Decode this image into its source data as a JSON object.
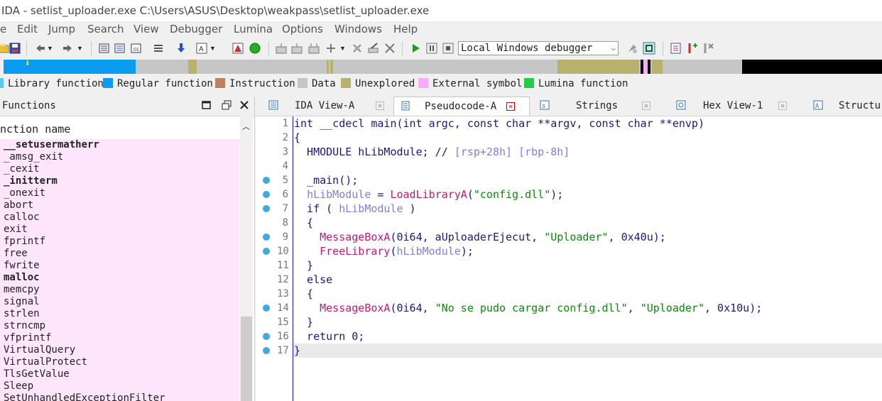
{
  "window": {
    "title": "IDA - setlist_uploader.exe C:\\Users\\ASUS\\Desktop\\weakpass\\setlist_uploader.exe"
  },
  "menu": [
    "e",
    "Edit",
    "Jump",
    "Search",
    "View",
    "Debugger",
    "Lumina",
    "Options",
    "Windows",
    "Help"
  ],
  "toolbar": {
    "debugger_select": "Local Windows debugger"
  },
  "legend": [
    {
      "label": "Library function",
      "color": "#57c9f2"
    },
    {
      "label": "Regular function",
      "color": "#0a9cf0"
    },
    {
      "label": "Instruction",
      "color": "#c08060"
    },
    {
      "label": "Data",
      "color": "#c6c6c6"
    },
    {
      "label": "Unexplored",
      "color": "#b7b36e"
    },
    {
      "label": "External symbol",
      "color": "#ffa8ff"
    },
    {
      "label": "Lumina function",
      "color": "#22cc44"
    }
  ],
  "functions_pane": {
    "title": "Functions",
    "column_header": "nction name",
    "items": [
      "__setusermatherr",
      "_amsg_exit",
      "_cexit",
      "_initterm",
      "_onexit",
      "abort",
      "calloc",
      "exit",
      "fprintf",
      "free",
      "fwrite",
      "malloc",
      "memcpy",
      "signal",
      "strlen",
      "strncmp",
      "vfprintf",
      "VirtualQuery",
      "VirtualProtect",
      "TlsGetValue",
      "Sleep",
      "SetUnhandledExceptionFilter"
    ]
  },
  "tabs": [
    {
      "label": "IDA View-A"
    },
    {
      "label": "Pseudocode-A",
      "active": true
    },
    {
      "label": "Strings"
    },
    {
      "label": "Hex View-1"
    },
    {
      "label": "Structur"
    }
  ],
  "code": {
    "lines": [
      {
        "n": "1",
        "dot": false
      },
      {
        "n": "2",
        "dot": false
      },
      {
        "n": "3",
        "dot": false
      },
      {
        "n": "4",
        "dot": false
      },
      {
        "n": "5",
        "dot": true
      },
      {
        "n": "6",
        "dot": true
      },
      {
        "n": "7",
        "dot": true
      },
      {
        "n": "8",
        "dot": false
      },
      {
        "n": "9",
        "dot": true
      },
      {
        "n": "10",
        "dot": true
      },
      {
        "n": "11",
        "dot": false
      },
      {
        "n": "12",
        "dot": false
      },
      {
        "n": "13",
        "dot": false
      },
      {
        "n": "14",
        "dot": true
      },
      {
        "n": "15",
        "dot": false
      },
      {
        "n": "16",
        "dot": true
      },
      {
        "n": "17",
        "dot": true
      }
    ],
    "t": {
      "l1": "int __cdecl main(int argc, const char **argv, const char **envp)",
      "l2": "{",
      "l3a": "  HMODULE hLibModule; // ",
      "l3b": "[rsp+28h] [rbp-8h]",
      "l5": "  _main();",
      "l6a": "  ",
      "l6b": "hLibModule",
      "l6c": " = ",
      "l6d": "LoadLibraryA",
      "l6e": "(",
      "l6f": "\"config.dll\"",
      "l6g": ");",
      "l7a": "  if ( ",
      "l7b": "hLibModule",
      "l7c": " )",
      "l8": "  {",
      "l9a": "    ",
      "l9b": "MessageBoxA",
      "l9c": "(0i64, aUploaderEjecut, ",
      "l9d": "\"Uploader\"",
      "l9e": ", 0x40u);",
      "l10a": "    ",
      "l10b": "FreeLibrary",
      "l10c": "(",
      "l10d": "hLibModule",
      "l10e": ");",
      "l11": "  }",
      "l12": "  else",
      "l13": "  {",
      "l14a": "    ",
      "l14b": "MessageBoxA",
      "l14c": "(0i64, ",
      "l14d": "\"No se pudo cargar config.dll\"",
      "l14e": ", ",
      "l14f": "\"Uploader\"",
      "l14g": ", 0x10u);",
      "l15": "  }",
      "l16": "  return 0;",
      "l17": "}"
    }
  }
}
